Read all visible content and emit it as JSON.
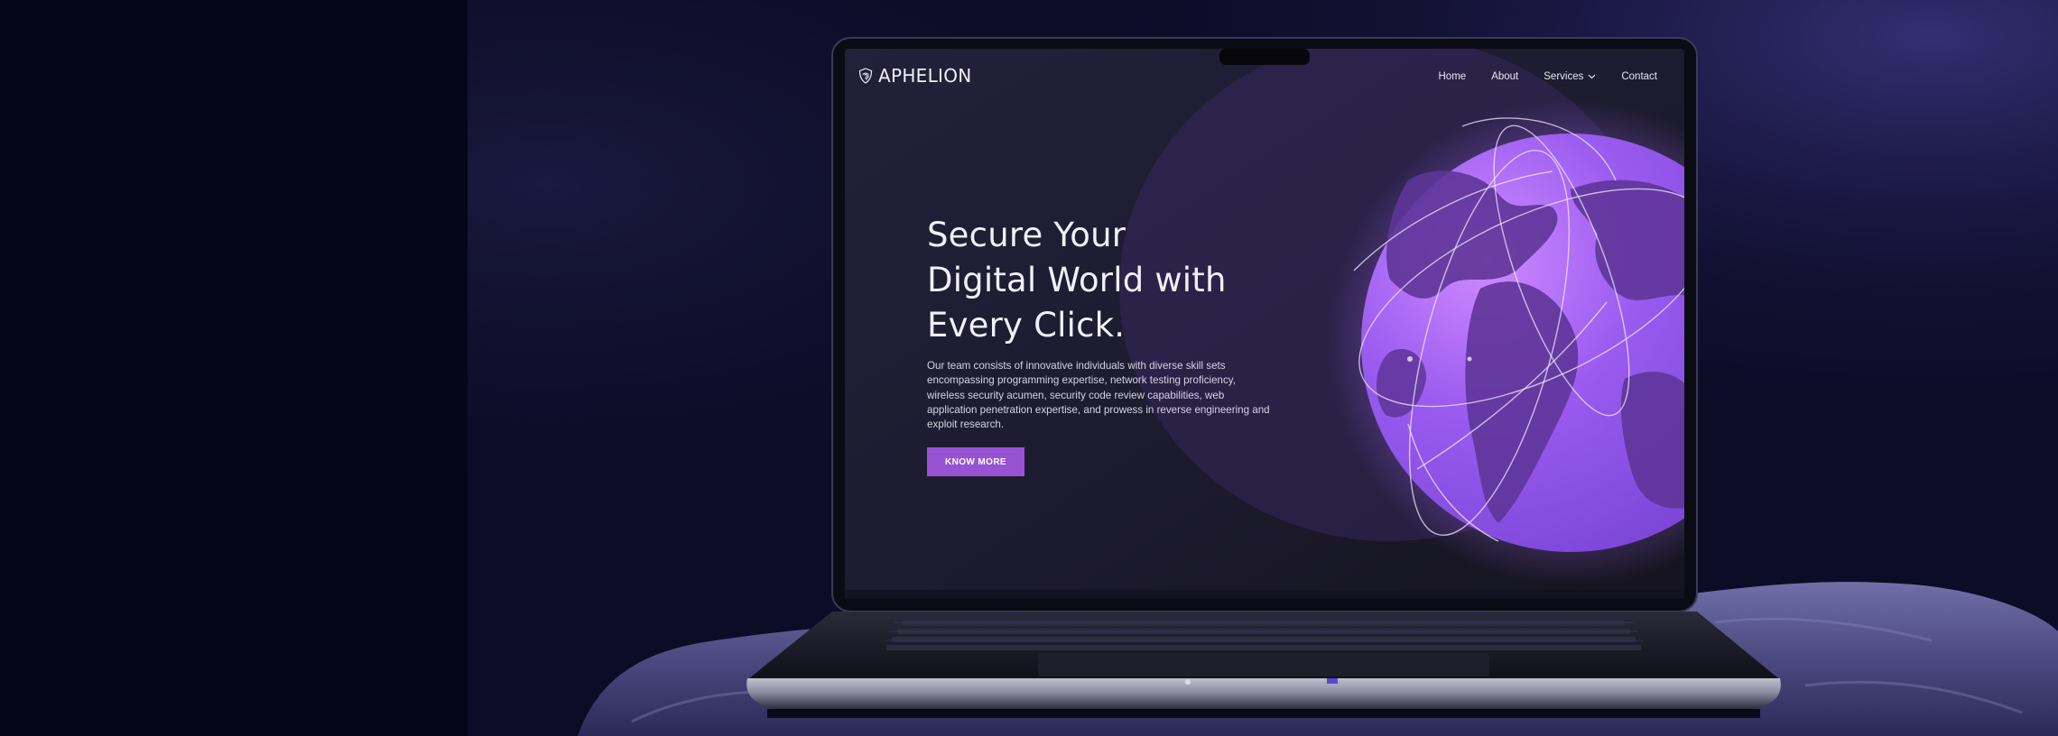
{
  "brand": {
    "logo_icon": "fingerprint-shield-icon",
    "name": "APHELION"
  },
  "nav": {
    "items": [
      {
        "label": "Home"
      },
      {
        "label": "About"
      },
      {
        "label": "Services",
        "icon": "chevron-down-icon"
      },
      {
        "label": "Contact"
      }
    ]
  },
  "hero": {
    "title_lines": [
      "Secure Your",
      "Digital World with",
      "Every Click."
    ],
    "description": "Our team consists of innovative individuals with diverse skill sets encompassing programming expertise, network testing proficiency, wireless security acumen, security code review capabilities, web application penetration expertise, and prowess in reverse engineering and exploit research.",
    "cta_label": "KNOW MORE"
  },
  "colors": {
    "page_background": "#07071a",
    "screen_background": "#1c1a2b",
    "accent": "#9852d4",
    "globe": "#8a52e6",
    "text_primary": "#f1eff7"
  }
}
